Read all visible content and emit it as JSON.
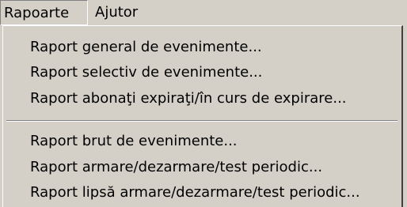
{
  "menubar": {
    "items": [
      {
        "label": "Rapoarte"
      },
      {
        "label": "Ajutor"
      }
    ]
  },
  "dropdown": {
    "items": [
      {
        "label": "Raport general de evenimente..."
      },
      {
        "label": "Raport selectiv de evenimente..."
      },
      {
        "label": "Raport abonaţi expiraţi/în curs de expirare..."
      },
      {
        "label": "Raport brut de evenimente..."
      },
      {
        "label": "Raport armare/dezarmare/test periodic..."
      },
      {
        "label": "Raport lipsă armare/dezarmare/test periodic..."
      }
    ]
  }
}
